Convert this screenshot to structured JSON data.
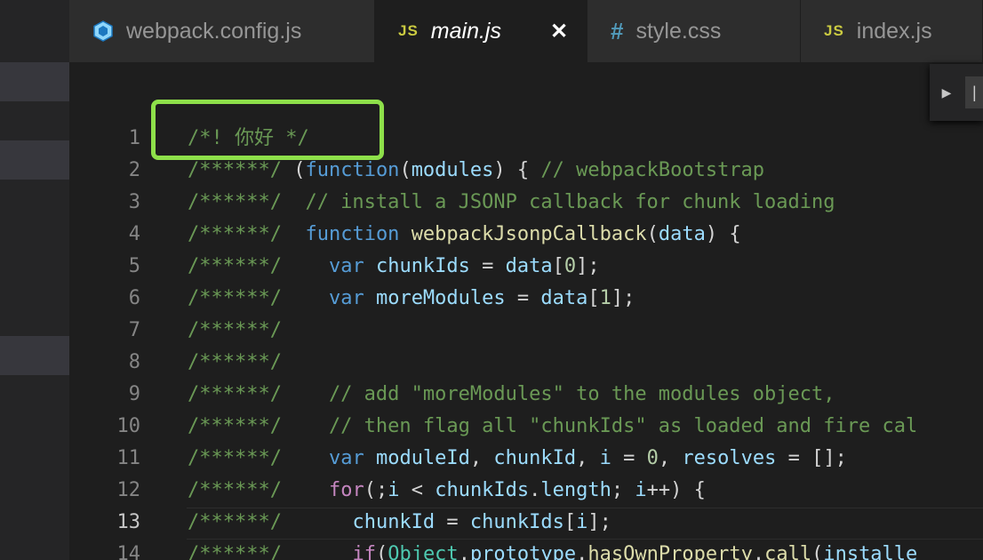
{
  "tabs": [
    {
      "label": "webpack.config.js",
      "icon": "webpack-icon",
      "active": false
    },
    {
      "label": "main.js",
      "icon": "js-icon",
      "badge": "JS",
      "active": true,
      "close": "✕"
    },
    {
      "label": "style.css",
      "icon": "css-hash-icon",
      "badge": "#",
      "active": false
    },
    {
      "label": "index.js",
      "icon": "js-icon",
      "badge": "JS",
      "active": false
    }
  ],
  "find_widget": {
    "toggle": "▶",
    "input_value": "|"
  },
  "current_line": "13",
  "lines": [
    {
      "n": "1",
      "code": "/*! 你好 */"
    },
    {
      "n": "2",
      "code": "/******/ (function(modules) { // webpackBootstrap"
    },
    {
      "n": "3",
      "code": "/******/  // install a JSONP callback for chunk loading"
    },
    {
      "n": "4",
      "code": "/******/  function webpackJsonpCallback(data) {"
    },
    {
      "n": "5",
      "code": "/******/    var chunkIds = data[0];"
    },
    {
      "n": "6",
      "code": "/******/    var moreModules = data[1];"
    },
    {
      "n": "7",
      "code": "/******/"
    },
    {
      "n": "8",
      "code": "/******/"
    },
    {
      "n": "9",
      "code": "/******/    // add \"moreModules\" to the modules object,"
    },
    {
      "n": "10",
      "code": "/******/    // then flag all \"chunkIds\" as loaded and fire cal"
    },
    {
      "n": "11",
      "code": "/******/    var moduleId, chunkId, i = 0, resolves = [];"
    },
    {
      "n": "12",
      "code": "/******/    for(;i < chunkIds.length; i++) {"
    },
    {
      "n": "13",
      "code": "/******/      chunkId = chunkIds[i];"
    },
    {
      "n": "14",
      "code": "/******/      if(Object.prototype.hasOwnProperty.call(installe"
    }
  ],
  "colors": {
    "comment": "#6a9955",
    "keyword": "#569cd6",
    "control": "#c586c0",
    "function": "#dcdcaa",
    "variable": "#9cdcfe",
    "number": "#b5cea8",
    "type": "#4ec9b0",
    "highlight_box": "#8ee04a"
  }
}
